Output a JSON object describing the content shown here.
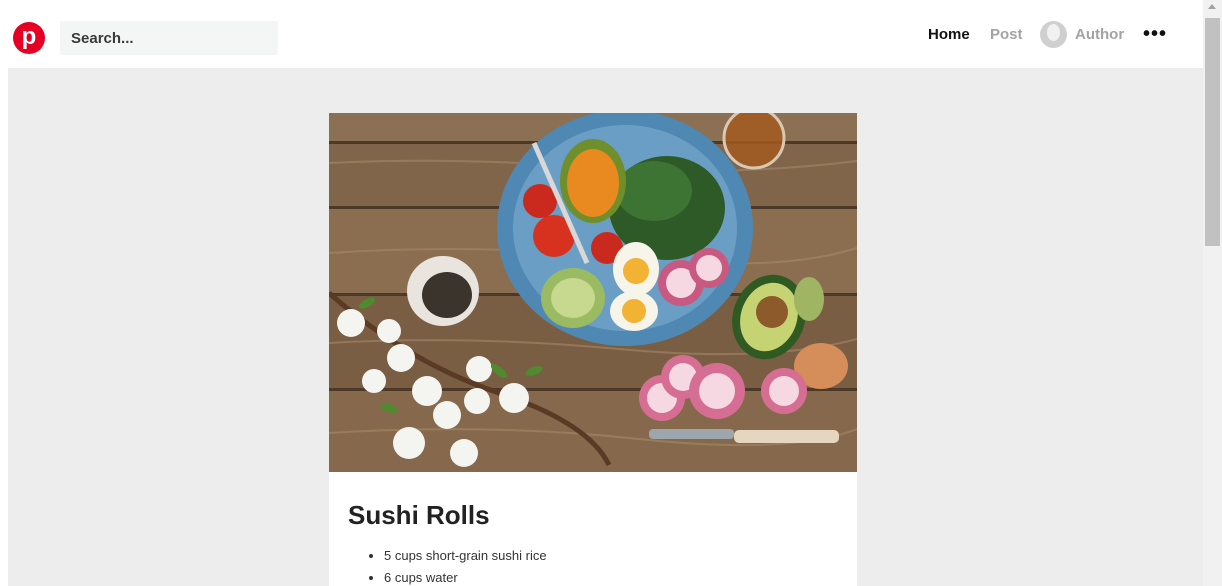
{
  "header": {
    "logo_letter": "p",
    "search_placeholder": "Search...",
    "nav": {
      "home": "Home",
      "post": "Post",
      "author": "Author",
      "more": "•••"
    }
  },
  "post": {
    "title": "Sushi Rolls",
    "ingredients": [
      "5 cups short-grain sushi rice",
      "6 cups water"
    ]
  },
  "colors": {
    "brand": "#e60023",
    "page_background": "#ededed",
    "nav_active": "#111111",
    "nav_inactive": "#a3a3a3"
  }
}
